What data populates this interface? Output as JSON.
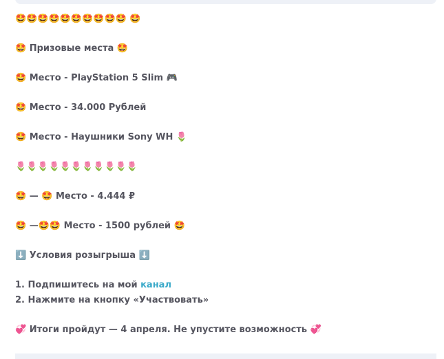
{
  "post": {
    "line_stars": "🤩🤩🤩🤩🤩🤩🤩🤩🤩🤩 🤩",
    "prize_heading": "🤩 Призовые места 🤩",
    "place_1": "🤩 Место - PlayStation 5 Slim 🎮",
    "place_2": "🤩 Место - 34.000 Рублей",
    "place_3": "🤩 Место - Наушники Sony WH 🌷",
    "line_tulips": "🌷🌷🌷🌷🌷🌷🌷🌷🌷🌷🌷",
    "place_range_1": "🤩 — 🤩 Место - 4.444 ₽",
    "place_range_2": "🤩 —🤩🤩 Место - 1500 рублей 🤩",
    "conditions_heading": "⬇️ Условия розыгрыша ⬇️",
    "condition_1_prefix": "1. Подпишитесь на мой ",
    "condition_1_link": "канал",
    "condition_2": "2. Нажмите на кнопку «Участвовать»",
    "results": "💞 Итоги пройдут — 4 апреля. Не упустите возможность 💞"
  },
  "colors": {
    "text": "#55555f",
    "link": "#3aa9c9",
    "panel": "#eef1f7"
  }
}
